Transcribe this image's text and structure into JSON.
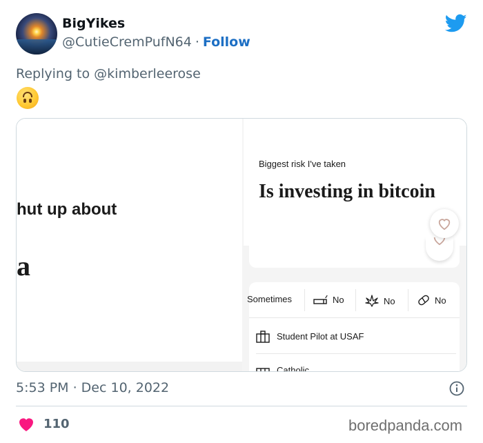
{
  "tweet": {
    "display_name": "BigYikes",
    "handle": "@CutieCremPufN64",
    "separator": "·",
    "follow_label": "Follow",
    "reply_to": "Replying to @kimberleerose",
    "emoji": "upside-down-face",
    "timestamp": "5:53 PM · Dec 10, 2022",
    "like_count": "110"
  },
  "media": {
    "left_text_1": "hut up about",
    "left_text_2": "a",
    "prompt_label": "Biggest risk I've taken",
    "prompt_answer": "Is investing in bitcoin",
    "vitals": [
      {
        "icon": "none",
        "label": "Sometimes"
      },
      {
        "icon": "smoking-icon",
        "label": "No"
      },
      {
        "icon": "cannabis-icon",
        "label": "No"
      },
      {
        "icon": "pill-icon",
        "label": "No"
      }
    ],
    "info_rows": [
      {
        "icon": "briefcase-icon",
        "label": "Student Pilot at USAF"
      },
      {
        "icon": "church-icon",
        "label": "Catholic"
      }
    ]
  },
  "watermark": "boredpanda.com",
  "colors": {
    "accent": "#1d6fc4",
    "twitter_blue": "#1d9bf0",
    "heart": "#f91880",
    "muted": "#536471"
  }
}
